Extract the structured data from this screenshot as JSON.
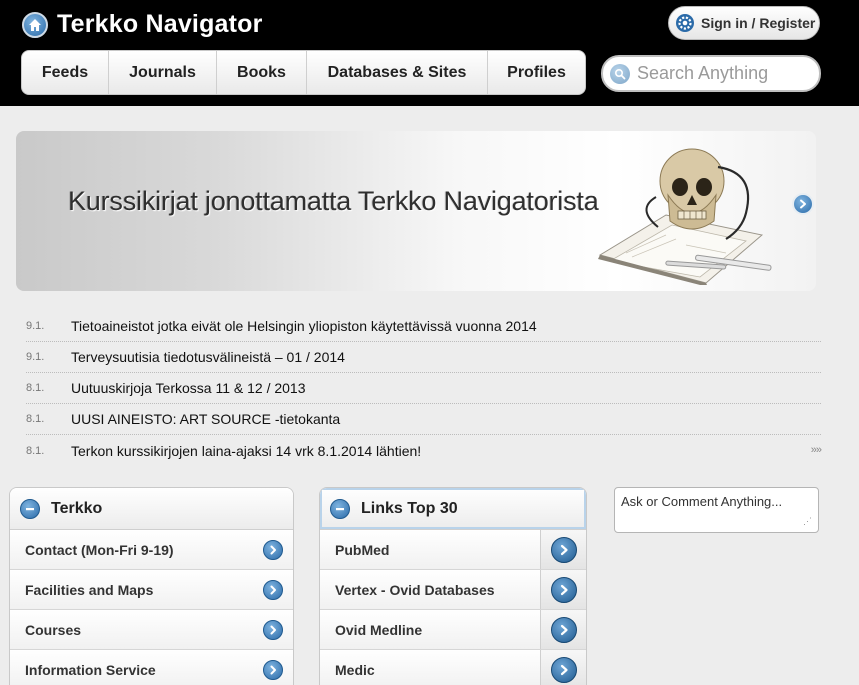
{
  "header": {
    "logo_icon": "home-icon",
    "title": "Terkko Navigator",
    "signin_label": "Sign in / Register",
    "signin_icon": "gear-icon"
  },
  "nav": {
    "tabs": [
      {
        "label": "Feeds"
      },
      {
        "label": "Journals"
      },
      {
        "label": "Books"
      },
      {
        "label": "Databases & Sites"
      },
      {
        "label": "Profiles"
      }
    ]
  },
  "search": {
    "placeholder": "Search Anything",
    "value": "",
    "icon": "search-icon"
  },
  "banner": {
    "text": "Kurssikirjat jonottamatta Terkko Navigatorista",
    "image": "skull-and-book-image",
    "next_icon": "chevron-right-icon"
  },
  "news": {
    "items": [
      {
        "date": "9.1.",
        "title": "Tietoaineistot jotka eivät ole Helsingin yliopiston käytettävissä vuonna 2014"
      },
      {
        "date": "9.1.",
        "title": "Terveysuutisia tiedotusvälineistä – 01 / 2014"
      },
      {
        "date": "8.1.",
        "title": "Uutuuskirjoja Terkossa 11 & 12 / 2013"
      },
      {
        "date": "8.1.",
        "title": "UUSI AINEISTO: ART SOURCE -tietokanta"
      },
      {
        "date": "8.1.",
        "title": "Terkon kurssikirjojen laina-ajaksi 14 vrk 8.1.2014 lähtien!"
      }
    ],
    "more_label": "»»"
  },
  "terkko_panel": {
    "title": "Terkko",
    "items": [
      {
        "label": "Contact (Mon-Fri 9-19)"
      },
      {
        "label": "Facilities and Maps"
      },
      {
        "label": "Courses"
      },
      {
        "label": "Information Service"
      }
    ]
  },
  "links_panel": {
    "title": "Links Top 30",
    "items": [
      {
        "label": "PubMed"
      },
      {
        "label": "Vertex - Ovid Databases"
      },
      {
        "label": "Ovid Medline"
      },
      {
        "label": "Medic"
      }
    ]
  },
  "ask": {
    "placeholder": "Ask or Comment Anything...",
    "value": ""
  },
  "colors": {
    "header_bg": "#000000",
    "accent_blue": "#2a6aa8",
    "page_bg": "#ededed"
  }
}
